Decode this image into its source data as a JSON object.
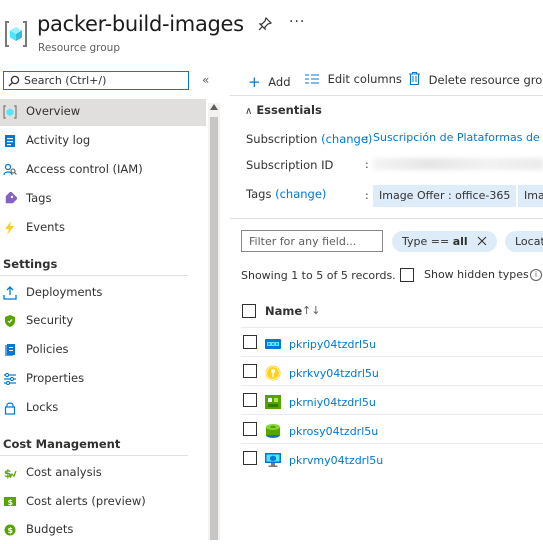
{
  "header": {
    "title": "packer-build-images",
    "subtitle": "Resource group",
    "more_label": "···"
  },
  "sidebar": {
    "search_placeholder": "Search (Ctrl+/)",
    "collapse_label": "«",
    "items_top": [
      {
        "label": "Overview",
        "icon": "resource-group-icon"
      },
      {
        "label": "Activity log",
        "icon": "activity-log-icon"
      },
      {
        "label": "Access control (IAM)",
        "icon": "iam-icon"
      },
      {
        "label": "Tags",
        "icon": "tag-icon"
      },
      {
        "label": "Events",
        "icon": "lightning-icon"
      }
    ],
    "settings_heading": "Settings",
    "settings_items": [
      {
        "label": "Deployments",
        "icon": "deploy-icon"
      },
      {
        "label": "Security",
        "icon": "shield-icon"
      },
      {
        "label": "Policies",
        "icon": "policy-icon"
      },
      {
        "label": "Properties",
        "icon": "properties-icon"
      },
      {
        "label": "Locks",
        "icon": "lock-icon"
      }
    ],
    "cost_heading": "Cost Management",
    "cost_items": [
      {
        "label": "Cost analysis",
        "icon": "cost-analysis-icon"
      },
      {
        "label": "Cost alerts (preview)",
        "icon": "cost-alert-icon"
      },
      {
        "label": "Budgets",
        "icon": "budget-icon"
      }
    ]
  },
  "toolbar": {
    "add_label": "Add",
    "edit_columns_label": "Edit columns",
    "delete_label": "Delete resource group"
  },
  "essentials": {
    "heading": "Essentials",
    "subscription_label": "Subscription",
    "subscription_change": "(change)",
    "subscription_value": "Suscripción de Plataformas de MS",
    "subscription_id_label": "Subscription ID",
    "tags_label": "Tags",
    "tags_change": "(change)",
    "colon": ":",
    "tags": [
      "Image Offer : office-365",
      "Ima"
    ]
  },
  "filter": {
    "placeholder": "Filter for any field...",
    "type_pill_prefix": "Type == ",
    "type_pill_value": "all",
    "location_pill": "Locat"
  },
  "records": {
    "summary": "Showing 1 to 5 of 5 records.",
    "show_hidden_label": "Show hidden types",
    "info_label": "i"
  },
  "table": {
    "name_header": "Name",
    "sort_glyph": "↑↓",
    "rows": [
      {
        "name": "pkripy04tzdrl5u",
        "icon": "public-ip-icon"
      },
      {
        "name": "pkrkvy04tzdrl5u",
        "icon": "key-vault-icon"
      },
      {
        "name": "pkrniy04tzdrl5u",
        "icon": "network-interface-icon"
      },
      {
        "name": "pkrosy04tzdrl5u",
        "icon": "disk-icon"
      },
      {
        "name": "pkrvmy04tzdrl5u",
        "icon": "virtual-machine-icon"
      }
    ]
  },
  "colors": {
    "accent": "#0078d4",
    "nav_active": "#e1dfdd",
    "chip_bg": "#deecf9"
  }
}
